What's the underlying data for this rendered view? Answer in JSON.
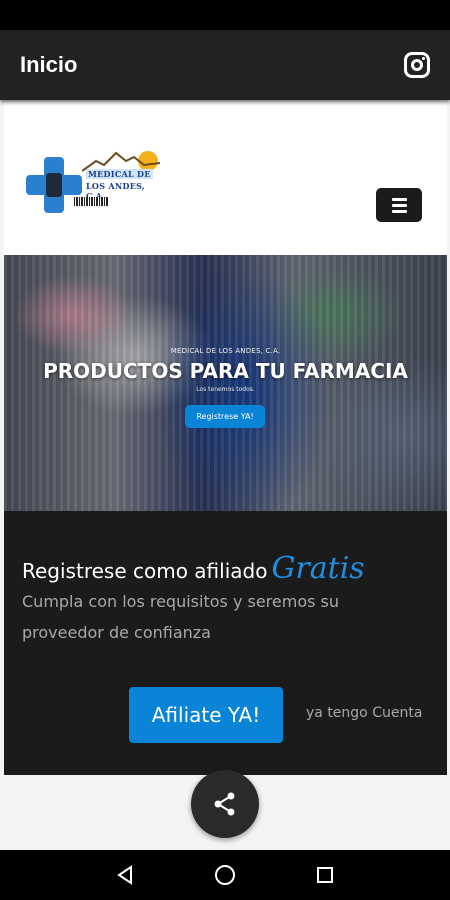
{
  "app_bar": {
    "title": "Inicio",
    "instagram_icon": "instagram-icon"
  },
  "site": {
    "logo": {
      "line1": "MEDICAL DE",
      "line2": "LOS ANDES, C.A."
    },
    "menu_icon": "hamburger-menu-icon",
    "hero": {
      "kicker": "MEDICAL DE LOS ANDES, C.A.",
      "title": "PRODUCTOS PARA TU FARMACIA",
      "subtitle": "Los tenemos todos.",
      "button_label": "Registrese YA!"
    },
    "register": {
      "title": "Registrese como afiliado",
      "highlight": "Gratis",
      "description": "Cumpla con los requisitos y seremos su proveedor de confianza",
      "affiliate_button": "Afiliate YA!",
      "account_link": "ya tengo Cuenta"
    }
  },
  "fab": {
    "icon": "share-icon"
  },
  "nav": {
    "back_icon": "back-triangle-icon",
    "home_icon": "home-circle-icon",
    "recents_icon": "recents-square-icon"
  },
  "colors": {
    "accent": "#0a84d6",
    "app_bar": "#222222",
    "section_dark": "#1b1b1b"
  }
}
